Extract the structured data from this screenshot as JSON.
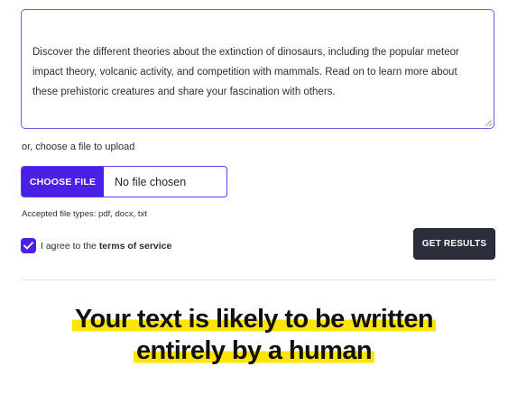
{
  "textarea": {
    "text": "Discover the different theories about the extinction of dinosaurs, including the popular meteor impact theory, volcanic activity, and competition with mammals. Read on to learn more about these prehistoric creatures and share your fascination with others."
  },
  "upload": {
    "label": "or, choose a file to upload",
    "button_label": "CHOOSE FILE",
    "status": "No file chosen",
    "accepted_types": "Accepted file types: pdf, docx, txt"
  },
  "terms": {
    "checked": true,
    "prefix": "I agree to the",
    "link_text": "terms of service"
  },
  "actions": {
    "get_results_label": "GET RESULTS"
  },
  "result": {
    "line1": "Your text is likely to be written",
    "line2": "entirely by a human"
  },
  "colors": {
    "accent": "#4a1fe6",
    "dark_button": "#2a2f3b",
    "highlight": "#ffe500"
  }
}
